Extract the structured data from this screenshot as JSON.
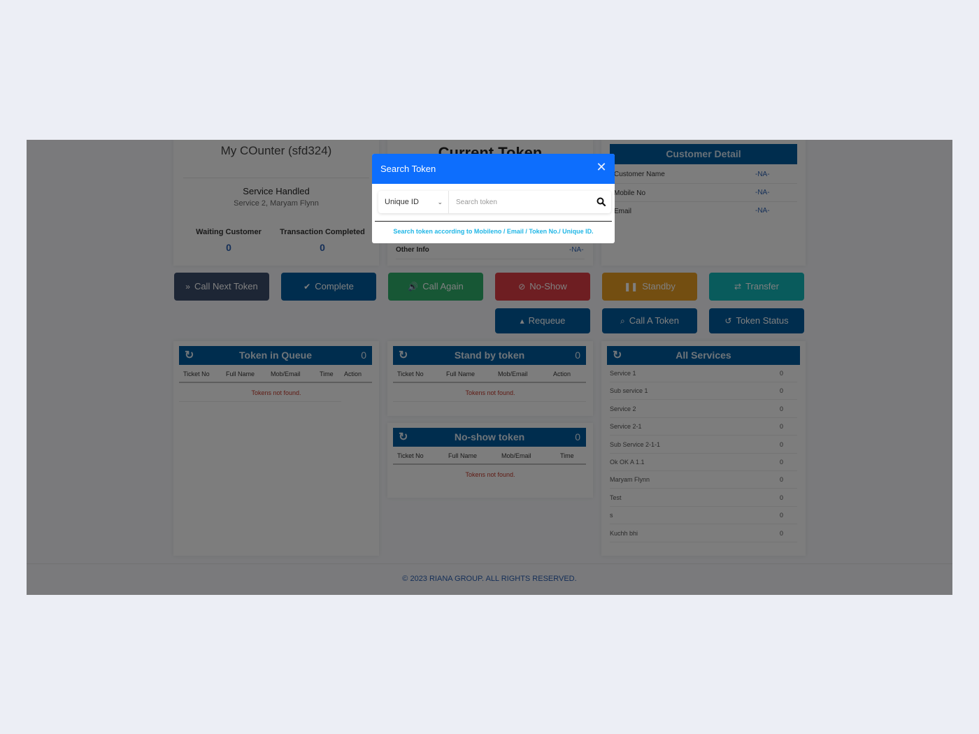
{
  "counter": {
    "title": "My COunter (sfd324)",
    "service_handled_label": "Service Handled",
    "service_handled_value": "Service 2, Maryam Flynn",
    "waiting_label": "Waiting Customer",
    "waiting_value": "0",
    "completed_label": "Transaction Completed",
    "completed_value": "0"
  },
  "current_token": {
    "title": "Current Token",
    "other_info_label": "Other Info",
    "other_info_value": "-NA-"
  },
  "customer_detail": {
    "title": "Customer Detail",
    "rows": [
      {
        "label": "Customer Name",
        "value": "-NA-"
      },
      {
        "label": "Mobile No",
        "value": "-NA-"
      },
      {
        "label": "Email",
        "value": "-NA-"
      }
    ]
  },
  "buttons": {
    "call_next": "Call Next Token",
    "complete": "Complete",
    "call_again": "Call Again",
    "no_show": "No-Show",
    "standby": "Standby",
    "transfer": "Transfer",
    "requeue": "Requeue",
    "call_a_token": "Call A Token",
    "token_status": "Token Status"
  },
  "token_queue": {
    "title": "Token in Queue",
    "count": "0",
    "columns": [
      "Ticket No",
      "Full Name",
      "Mob/Email",
      "Time",
      "Action"
    ],
    "empty": "Tokens not found."
  },
  "standby_tokens": {
    "title": "Stand by token",
    "count": "0",
    "columns": [
      "Ticket No",
      "Full Name",
      "Mob/Email",
      "Action"
    ],
    "empty": "Tokens not found."
  },
  "noshow_tokens": {
    "title": "No-show token",
    "count": "0",
    "columns": [
      "Ticket No",
      "Full Name",
      "Mob/Email",
      "Time"
    ],
    "empty": "Tokens not found."
  },
  "all_services": {
    "title": "All Services",
    "items": [
      {
        "name": "Service 1",
        "count": "0"
      },
      {
        "name": "Sub service 1",
        "count": "0"
      },
      {
        "name": "Service 2",
        "count": "0"
      },
      {
        "name": "Service 2-1",
        "count": "0"
      },
      {
        "name": "Sub Service 2-1-1",
        "count": "0"
      },
      {
        "name": "Ok OK A 1.1",
        "count": "0"
      },
      {
        "name": "Maryam Flynn",
        "count": "0"
      },
      {
        "name": "Test",
        "count": "0"
      },
      {
        "name": "s",
        "count": "0"
      },
      {
        "name": "Kuchh bhi",
        "count": "0"
      }
    ]
  },
  "footer": {
    "text": "© 2023 RIANA GROUP. ALL RIGHTS RESERVED."
  },
  "modal": {
    "title": "Search Token",
    "select_value": "Unique ID",
    "search_value": "",
    "search_placeholder": "Search token",
    "hint": "Search token according to Mobileno / Email / Token No./ Unique ID."
  },
  "colors": {
    "primary_dark": "#005a9c",
    "modal_header": "#0d6efd",
    "call_next": "#3b4d6b",
    "call_again": "#2fae6a",
    "no_show": "#dc3d44",
    "standby": "#e79d22",
    "transfer": "#12b6b8",
    "hint": "#1fb6e6",
    "error": "#c0392b"
  }
}
